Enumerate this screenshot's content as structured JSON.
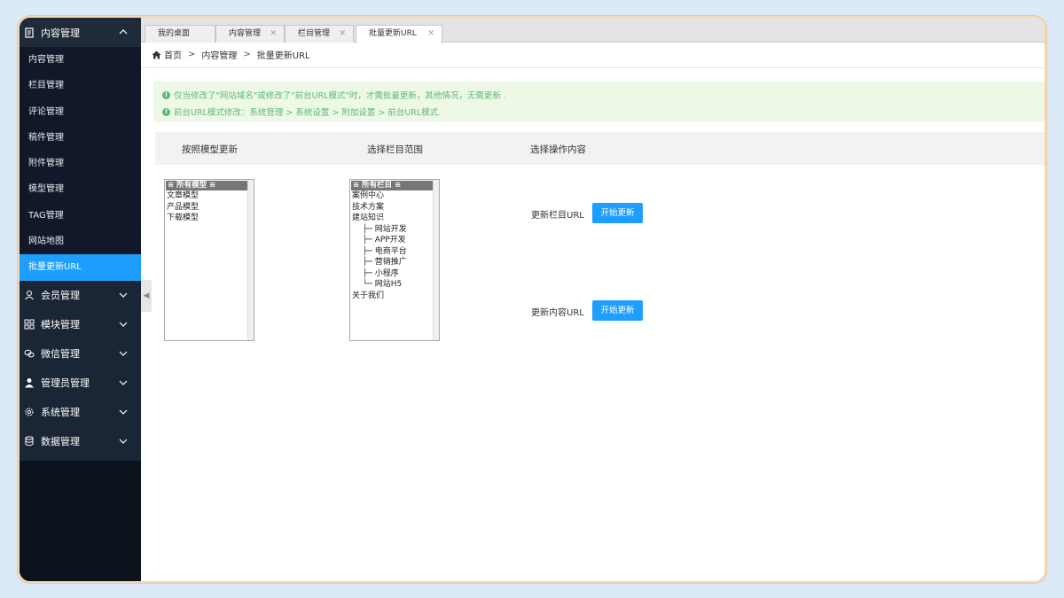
{
  "sidebar": {
    "groups": [
      {
        "label": "内容管理",
        "icon": "document-icon",
        "expanded": true
      },
      {
        "label": "会员管理",
        "icon": "user-icon"
      },
      {
        "label": "模块管理",
        "icon": "grid-icon"
      },
      {
        "label": "微信管理",
        "icon": "wechat-icon"
      },
      {
        "label": "管理员管理",
        "icon": "admin-icon"
      },
      {
        "label": "系统管理",
        "icon": "gear-icon"
      },
      {
        "label": "数据管理",
        "icon": "database-icon"
      }
    ],
    "items": [
      "内容管理",
      "栏目管理",
      "评论管理",
      "稿件管理",
      "附件管理",
      "模型管理",
      "TAG管理",
      "网站地图",
      "批量更新URL"
    ],
    "active_item": "批量更新URL"
  },
  "tabs": [
    {
      "label": "我的桌面"
    },
    {
      "label": "内容管理"
    },
    {
      "label": "栏目管理"
    },
    {
      "label": "批量更新URL",
      "active": true
    }
  ],
  "breadcrumb": {
    "home": "首页",
    "sep": ">",
    "level1": "内容管理",
    "level2": "批量更新URL"
  },
  "notice": {
    "line1": "仅当修改了\"网站域名\"或修改了\"前台URL模式\"时，才需批量更新，其他情况，无需更新 .",
    "line2": "前台URL模式修改：系统管理 > 系统设置 > 附加设置 > 前台URL模式."
  },
  "table_headers": {
    "by_model": "按照模型更新",
    "column_scope": "选择栏目范围",
    "operation": "选择操作内容"
  },
  "model_list": {
    "selected": "≡ 所有模型 ≡",
    "options": [
      "文章模型",
      "产品模型",
      "下载模型"
    ]
  },
  "column_list": {
    "selected": "≡ 所有栏目 ≡",
    "options": [
      "案例中心",
      "技术方案",
      "建站知识",
      "├─ 网站开发",
      "├─ APP开发",
      "├─ 电商平台",
      "├─ 营销推广",
      "├─ 小程序",
      "└─ 网站H5",
      "关于我们"
    ]
  },
  "actions": {
    "column_url_label": "更新栏目URL",
    "column_url_button": "开始更新",
    "content_url_label": "更新内容URL",
    "content_url_button": "开始更新"
  },
  "colors": {
    "accent": "#1e9fff",
    "sidebar_bg": "#1a2535",
    "notice_text": "#5fb878"
  }
}
